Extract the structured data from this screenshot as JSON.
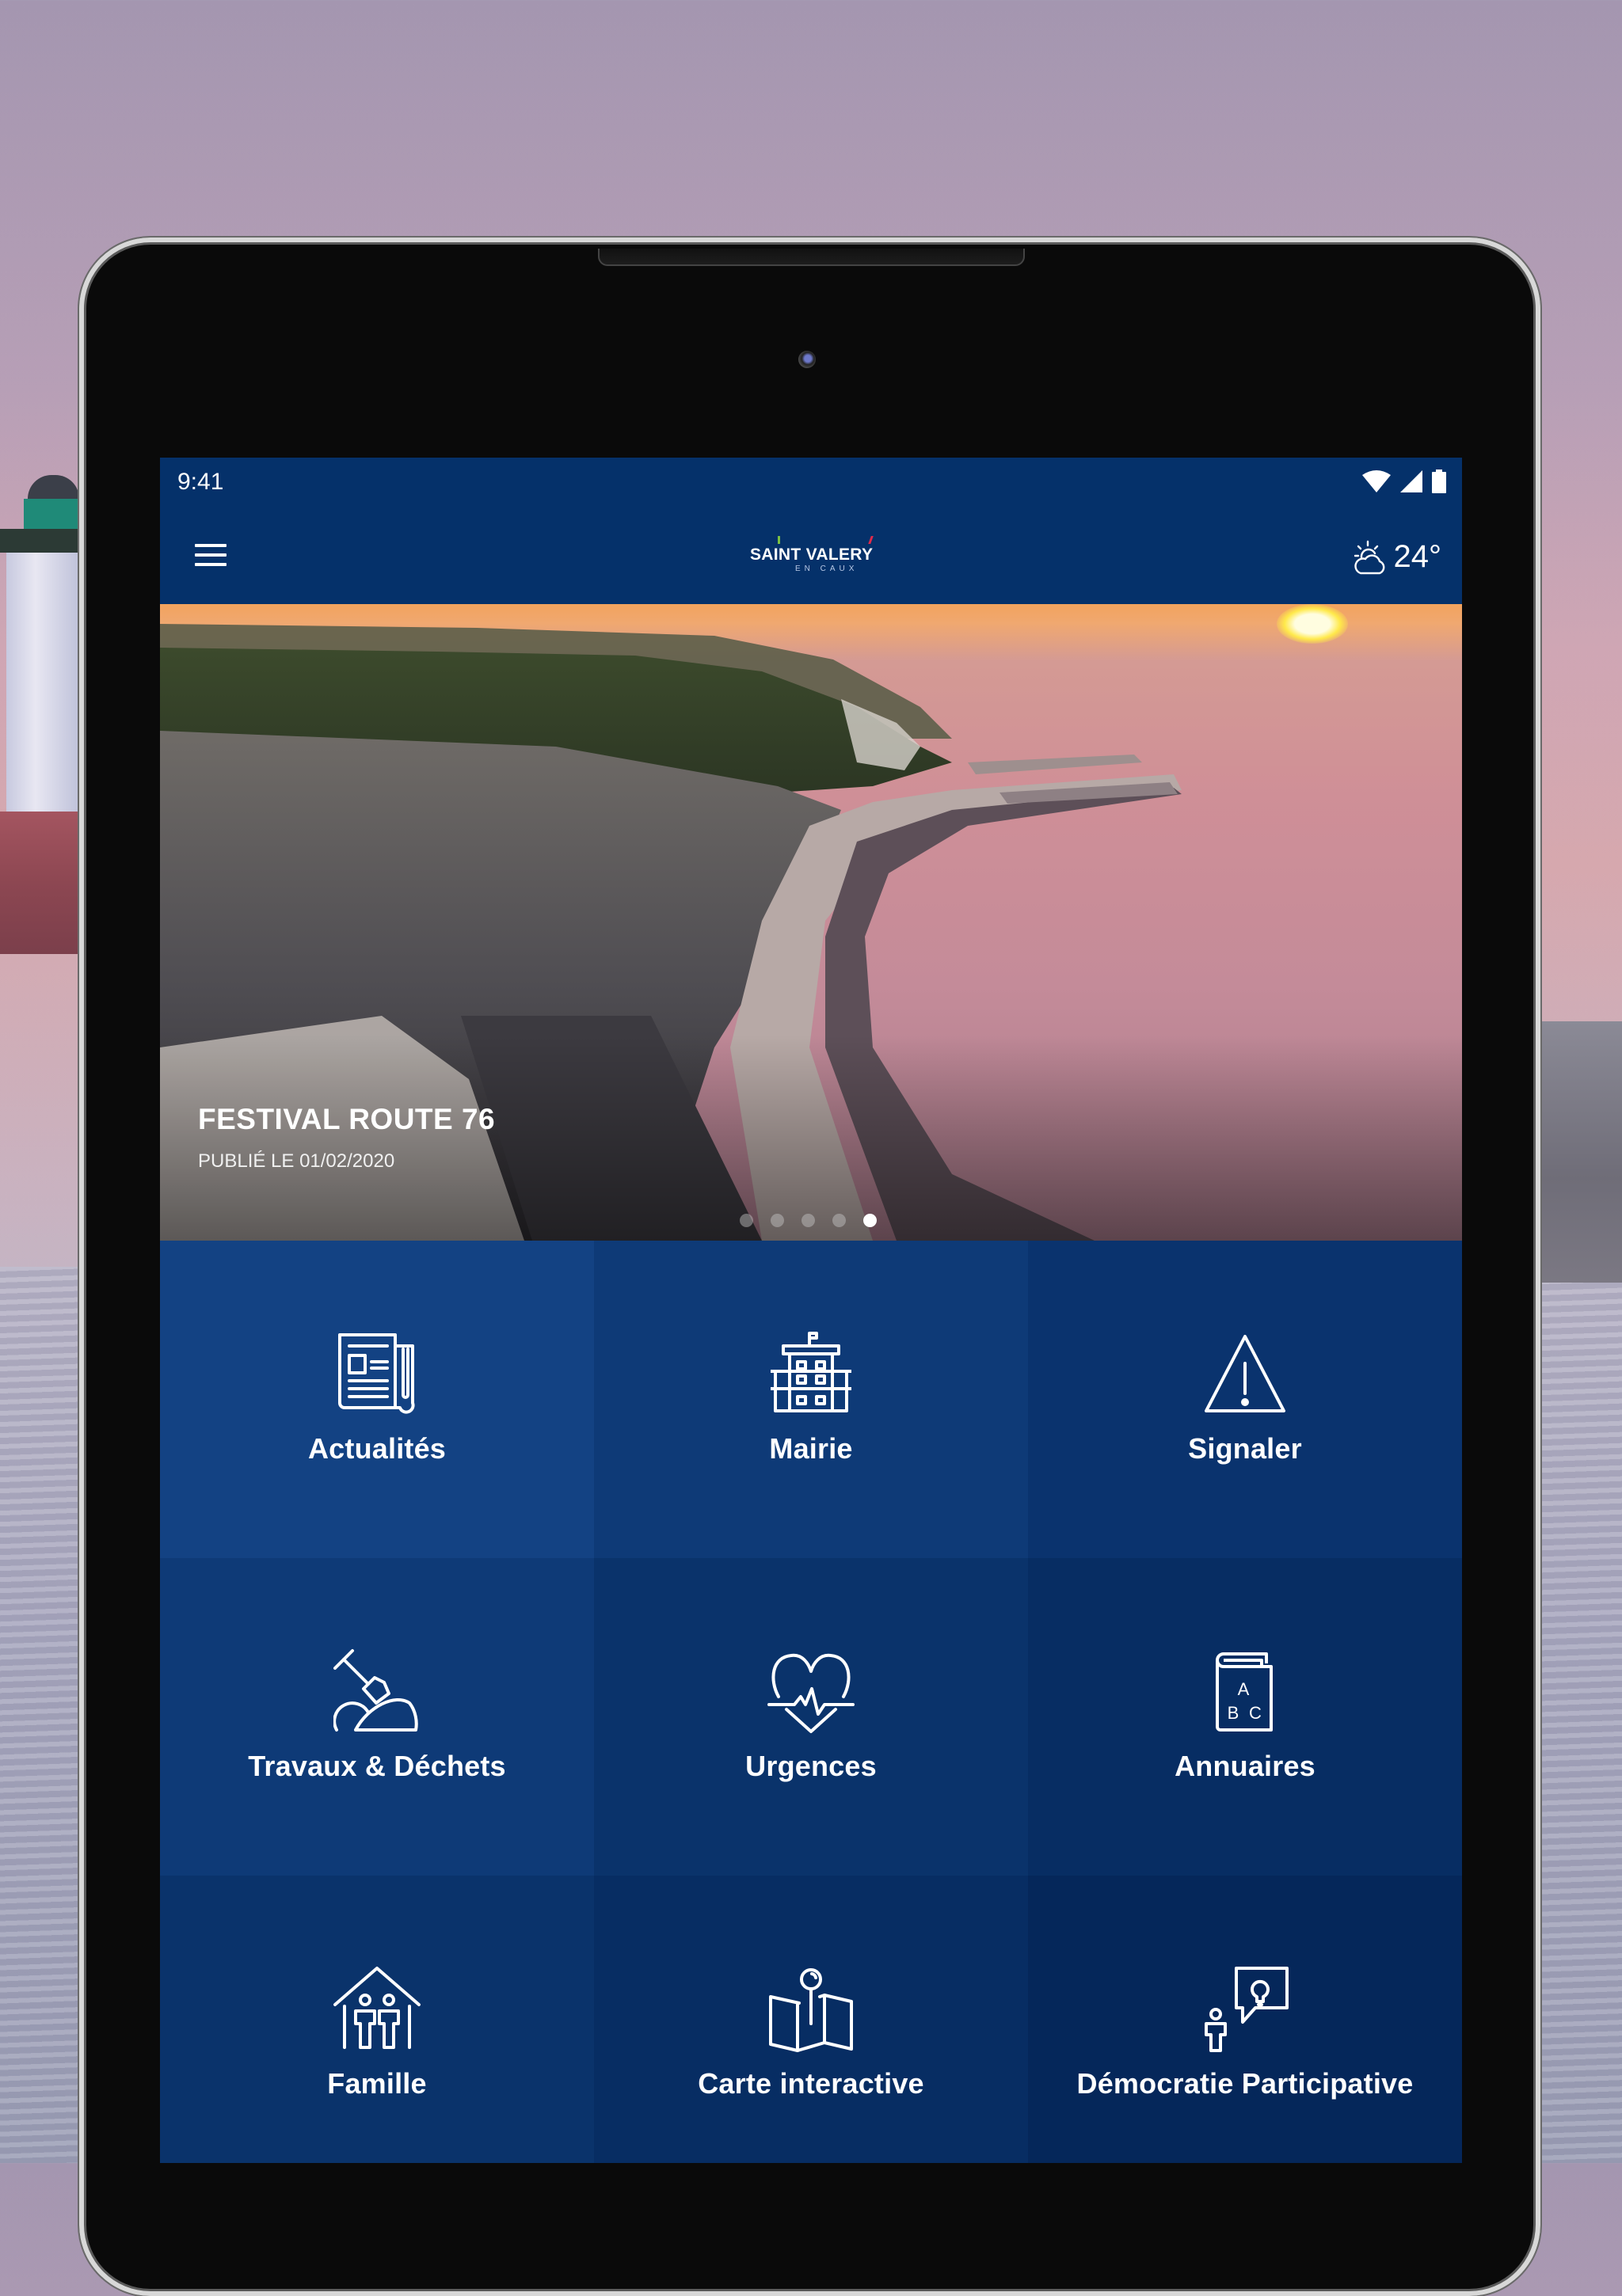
{
  "status_bar": {
    "time": "9:41",
    "icons": [
      "wifi-icon",
      "signal-icon",
      "battery-icon"
    ]
  },
  "app_bar": {
    "menu_icon": "hamburger-menu-icon",
    "logo": {
      "main": "SAINT VALERY",
      "sub": "EN CAUX"
    },
    "weather": {
      "icon": "partly-cloudy-icon",
      "temperature": "24°"
    }
  },
  "hero": {
    "title": "FESTIVAL ROUTE 76",
    "date": "PUBLIÉ LE 01/02/2020",
    "slides_total": 5,
    "active_slide": 5
  },
  "tiles": [
    {
      "label": "Actualités",
      "icon": "newspaper-icon",
      "color": "#134283"
    },
    {
      "label": "Mairie",
      "icon": "town-hall-icon",
      "color": "#0e3a77"
    },
    {
      "label": "Signaler",
      "icon": "warning-icon",
      "color": "#0a336e"
    },
    {
      "label": "Travaux & Déchets",
      "icon": "shovel-icon",
      "color": "#0e3a77"
    },
    {
      "label": "Urgences",
      "icon": "heart-pulse-icon",
      "color": "#0a336b"
    },
    {
      "label": "Annuaires",
      "icon": "address-book-icon",
      "color": "#072d63"
    },
    {
      "label": "Famille",
      "icon": "family-house-icon",
      "color": "#0a336b"
    },
    {
      "label": "Carte interactive",
      "icon": "map-pin-icon",
      "color": "#072d63"
    },
    {
      "label": "Démocratie Participative",
      "icon": "idea-speech-icon",
      "color": "#05275a"
    }
  ]
}
